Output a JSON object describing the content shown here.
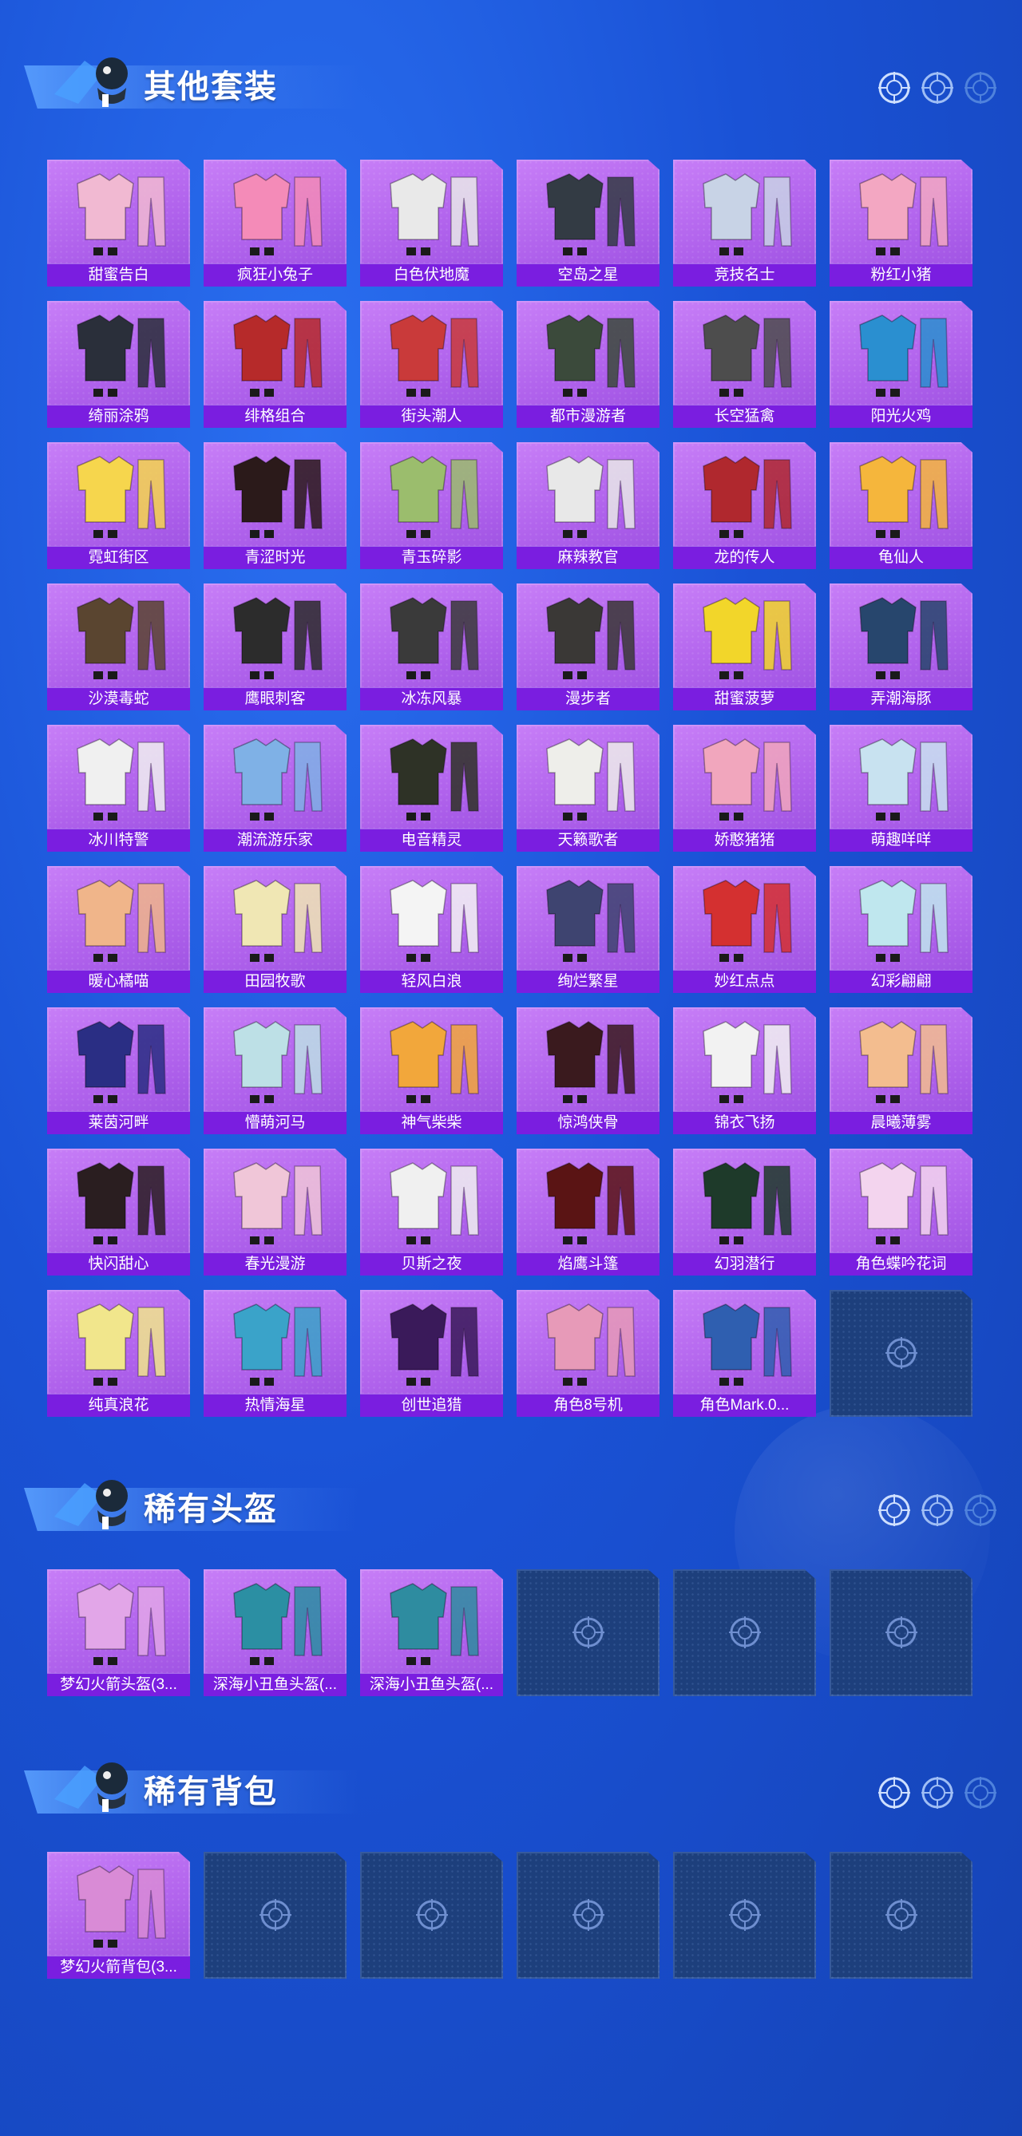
{
  "sections": {
    "other_sets": {
      "title": "其他套装",
      "items": [
        {
          "label": "甜蜜告白",
          "color": "#f1b9d2"
        },
        {
          "label": "疯狂小兔子",
          "color": "#f48bb8"
        },
        {
          "label": "白色伏地魔",
          "color": "#e9e9e9"
        },
        {
          "label": "空岛之星",
          "color": "#333b44"
        },
        {
          "label": "竞技名士",
          "color": "#c8d3e6"
        },
        {
          "label": "粉红小猪",
          "color": "#f3a7c2"
        },
        {
          "label": "绮丽涂鸦",
          "color": "#2a2f3a"
        },
        {
          "label": "绯格组合",
          "color": "#b62a2a"
        },
        {
          "label": "街头潮人",
          "color": "#c93a3a"
        },
        {
          "label": "都市漫游者",
          "color": "#3b4a3b"
        },
        {
          "label": "长空猛禽",
          "color": "#4d4d4d"
        },
        {
          "label": "阳光火鸡",
          "color": "#2a8fd0"
        },
        {
          "label": "霓虹街区",
          "color": "#f6d64d"
        },
        {
          "label": "青涩时光",
          "color": "#2b1a1a"
        },
        {
          "label": "青玉碎影",
          "color": "#9bbd6d"
        },
        {
          "label": "麻辣教官",
          "color": "#e8e8e8"
        },
        {
          "label": "龙的传人",
          "color": "#b0282e"
        },
        {
          "label": "龟仙人",
          "color": "#f5b63c"
        },
        {
          "label": "沙漠毒蛇",
          "color": "#5a4530"
        },
        {
          "label": "鹰眼刺客",
          "color": "#2c2c2c"
        },
        {
          "label": "冰冻风暴",
          "color": "#3a3a3a"
        },
        {
          "label": "漫步者",
          "color": "#3a3836"
        },
        {
          "label": "甜蜜菠萝",
          "color": "#f2d62a"
        },
        {
          "label": "弄潮海豚",
          "color": "#27466d"
        },
        {
          "label": "冰川特警",
          "color": "#f0f0f0"
        },
        {
          "label": "潮流游乐家",
          "color": "#7fb1e6"
        },
        {
          "label": "电音精灵",
          "color": "#2e3226"
        },
        {
          "label": "天籁歌者",
          "color": "#eeeeea"
        },
        {
          "label": "娇憨猪猪",
          "color": "#f1a6bd"
        },
        {
          "label": "萌趣咩咩",
          "color": "#c8e2f0"
        },
        {
          "label": "暖心橘喵",
          "color": "#f0b58a"
        },
        {
          "label": "田园牧歌",
          "color": "#f0e7b4"
        },
        {
          "label": "轻风白浪",
          "color": "#f4f4f4"
        },
        {
          "label": "绚烂繁星",
          "color": "#3e4470"
        },
        {
          "label": "妙红点点",
          "color": "#d43030"
        },
        {
          "label": "幻彩翩翩",
          "color": "#bfe7ee"
        },
        {
          "label": "莱茵河畔",
          "color": "#2a2e84"
        },
        {
          "label": "懵萌河马",
          "color": "#bde0e6"
        },
        {
          "label": "神气柴柴",
          "color": "#f2a73b"
        },
        {
          "label": "惊鸿侠骨",
          "color": "#3a1a1e"
        },
        {
          "label": "锦衣飞扬",
          "color": "#f2f2f2"
        },
        {
          "label": "晨曦薄雾",
          "color": "#f3bd8f"
        },
        {
          "label": "快闪甜心",
          "color": "#2a1e20"
        },
        {
          "label": "春光漫游",
          "color": "#f0c6d8"
        },
        {
          "label": "贝斯之夜",
          "color": "#f0f0f0"
        },
        {
          "label": "焰鹰斗篷",
          "color": "#5a1414"
        },
        {
          "label": "幻羽潜行",
          "color": "#1e3a2a"
        },
        {
          "label": "角色蝶吟花词",
          "color": "#f3d4ee"
        },
        {
          "label": "纯真浪花",
          "color": "#f1e68c"
        },
        {
          "label": "热情海星",
          "color": "#3aa3c9"
        },
        {
          "label": "创世追猎",
          "color": "#3a1a5a"
        },
        {
          "label": "角色8号机",
          "color": "#e79ab8"
        },
        {
          "label": "角色Mark.0...",
          "color": "#2f5fb0"
        }
      ],
      "empty_slots": 1
    },
    "rare_helmets": {
      "title": "稀有头盔",
      "items": [
        {
          "label": "梦幻火箭头盔(3...",
          "color": "#e2a6e8"
        },
        {
          "label": "深海小丑鱼头盔(...",
          "color": "#2b8fa3"
        },
        {
          "label": "深海小丑鱼头盔(...",
          "color": "#2e8ca0"
        }
      ],
      "empty_slots": 3
    },
    "rare_backpacks": {
      "title": "稀有背包",
      "items": [
        {
          "label": "梦幻火箭背包(3...",
          "color": "#d98bd6"
        }
      ],
      "empty_slots": 5
    }
  },
  "icons": {
    "section": "parachute-mascot-icon",
    "crosshair": "crosshair-icon",
    "empty_slot": "empty-slot-crosshair-icon"
  }
}
